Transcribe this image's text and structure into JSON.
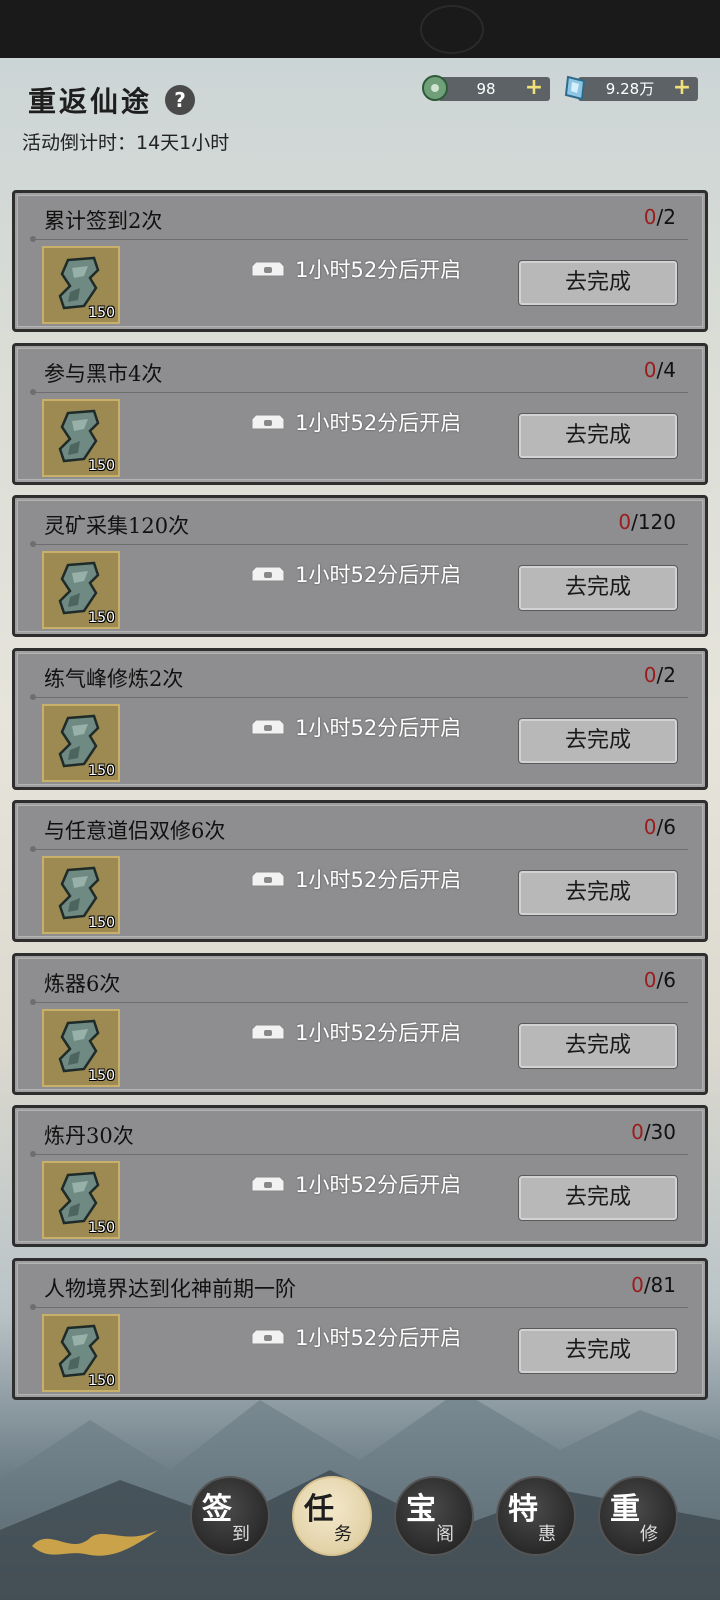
{
  "header": {
    "title": "重返仙途",
    "help_icon": "?",
    "countdown": "活动倒计时：14天1小时"
  },
  "currencies": [
    {
      "name": "jade-icon",
      "value": "98",
      "plus": "+"
    },
    {
      "name": "spirit-stone-icon",
      "value": "9.28万",
      "plus": "+"
    }
  ],
  "tasks": [
    {
      "name": "累计签到2次",
      "current": "0",
      "total": "/2",
      "reward_count": "150",
      "lock_text": "1小时52分后开启",
      "button": "去完成"
    },
    {
      "name": "参与黑市4次",
      "current": "0",
      "total": "/4",
      "reward_count": "150",
      "lock_text": "1小时52分后开启",
      "button": "去完成"
    },
    {
      "name": "灵矿采集120次",
      "current": "0",
      "total": "/120",
      "reward_count": "150",
      "lock_text": "1小时52分后开启",
      "button": "去完成"
    },
    {
      "name": "练气峰修炼2次",
      "current": "0",
      "total": "/2",
      "reward_count": "150",
      "lock_text": "1小时52分后开启",
      "button": "去完成"
    },
    {
      "name": "与任意道侣双修6次",
      "current": "0",
      "total": "/6",
      "reward_count": "150",
      "lock_text": "1小时52分后开启",
      "button": "去完成"
    },
    {
      "name": "炼器6次",
      "current": "0",
      "total": "/6",
      "reward_count": "150",
      "lock_text": "1小时52分后开启",
      "button": "去完成"
    },
    {
      "name": "炼丹30次",
      "current": "0",
      "total": "/30",
      "reward_count": "150",
      "lock_text": "1小时52分后开启",
      "button": "去完成"
    },
    {
      "name": "人物境界达到化神前期一阶",
      "current": "0",
      "total": "/81",
      "reward_count": "150",
      "lock_text": "1小时52分后开启",
      "button": "去完成"
    }
  ],
  "nav": [
    {
      "big": "签",
      "small": "到",
      "active": false
    },
    {
      "big": "任",
      "small": "务",
      "active": true
    },
    {
      "big": "宝",
      "small": "阁",
      "active": false
    },
    {
      "big": "特",
      "small": "惠",
      "active": false
    },
    {
      "big": "重",
      "small": "修",
      "active": false
    }
  ],
  "colors": {
    "progress_current": "#9b1c1c",
    "panel": "#8e8e90",
    "button": "#b8b8b8"
  }
}
